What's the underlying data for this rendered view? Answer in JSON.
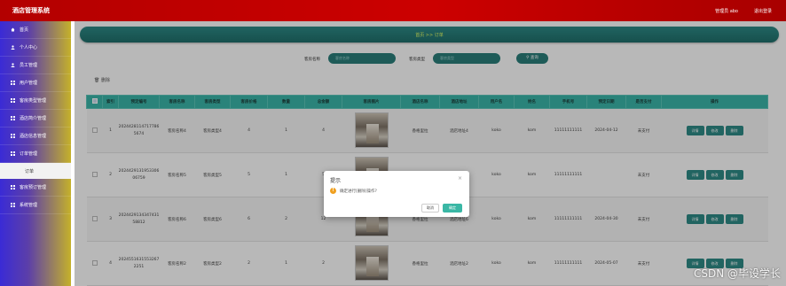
{
  "header": {
    "app_title": "酒店管理系统",
    "user_label": "管理员 abo",
    "logout_label": "退出登录"
  },
  "sidebar": {
    "items": [
      {
        "label": "首页",
        "icon": "home-icon"
      },
      {
        "label": "个人中心",
        "icon": "user-icon"
      },
      {
        "label": "员工管理",
        "icon": "user-icon"
      },
      {
        "label": "用户管理",
        "icon": "grid-icon"
      },
      {
        "label": "客房类型管理",
        "icon": "grid-icon"
      },
      {
        "label": "酒店简介管理",
        "icon": "grid-icon"
      },
      {
        "label": "酒店信息管理",
        "icon": "grid-icon"
      },
      {
        "label": "订单管理",
        "icon": "grid-icon"
      },
      {
        "label": "订单",
        "icon": ""
      },
      {
        "label": "客房预订管理",
        "icon": "grid-icon"
      },
      {
        "label": "系统管理",
        "icon": "grid-icon"
      }
    ]
  },
  "breadcrumb": {
    "text": "首页 >> 订单"
  },
  "search": {
    "room_name_label": "客房名称",
    "room_name_placeholder": "客房名称",
    "room_type_label": "客房类型",
    "room_type_placeholder": "客房类型",
    "query_button": "查询"
  },
  "toolbar": {
    "delete_label": "删除"
  },
  "table": {
    "headers": [
      "",
      "索引",
      "预定编号",
      "客房名称",
      "客房类型",
      "客房价格",
      "数量",
      "总金额",
      "客房图片",
      "酒店名称",
      "酒店地址",
      "用户名",
      "姓名",
      "手机号",
      "预定日期",
      "是否支付",
      "操作"
    ],
    "rows": [
      {
        "index": "1",
        "order_no": "20244281147177865674",
        "room_name": "客房名称4",
        "room_type": "客房类型4",
        "price": "4",
        "qty": "1",
        "total": "4",
        "hotel_name": "香格里拉",
        "hotel_addr": "酒店地址4",
        "username": "koko",
        "name": "kom",
        "phone": "11111111111",
        "date": "2024-04-12",
        "paid": "未支付"
      },
      {
        "index": "2",
        "order_no": "202442913195330606759",
        "room_name": "客房名称5",
        "room_type": "客房类型5",
        "price": "5",
        "qty": "1",
        "total": "5",
        "hotel_name": "香格里拉",
        "hotel_addr": "酒店地址5",
        "username": "koko",
        "name": "kom",
        "phone": "11111111111",
        "date": "",
        "paid": "未支付"
      },
      {
        "index": "3",
        "order_no": "202442913434743158812",
        "room_name": "客房名称6",
        "room_type": "客房类型6",
        "price": "6",
        "qty": "2",
        "total": "12",
        "hotel_name": "香格里拉",
        "hotel_addr": "酒店地址6",
        "username": "koko",
        "name": "kom",
        "phone": "11111111111",
        "date": "2024-04-30",
        "paid": "未支付"
      },
      {
        "index": "4",
        "order_no": "20245516315532672251",
        "room_name": "客房名称2",
        "room_type": "客房类型2",
        "price": "2",
        "qty": "1",
        "total": "2",
        "hotel_name": "香格里拉",
        "hotel_addr": "酒店地址2",
        "username": "koko",
        "name": "kom",
        "phone": "11111111111",
        "date": "2024-05-07",
        "paid": "未支付"
      }
    ],
    "actions": [
      "详情",
      "修改",
      "删除"
    ]
  },
  "dialog": {
    "title": "提示",
    "close_icon": "close-icon",
    "message": "确定进行[删除]操作?",
    "cancel_label": "取消",
    "ok_label": "确定"
  },
  "watermark": "CSDN @毕设学长"
}
